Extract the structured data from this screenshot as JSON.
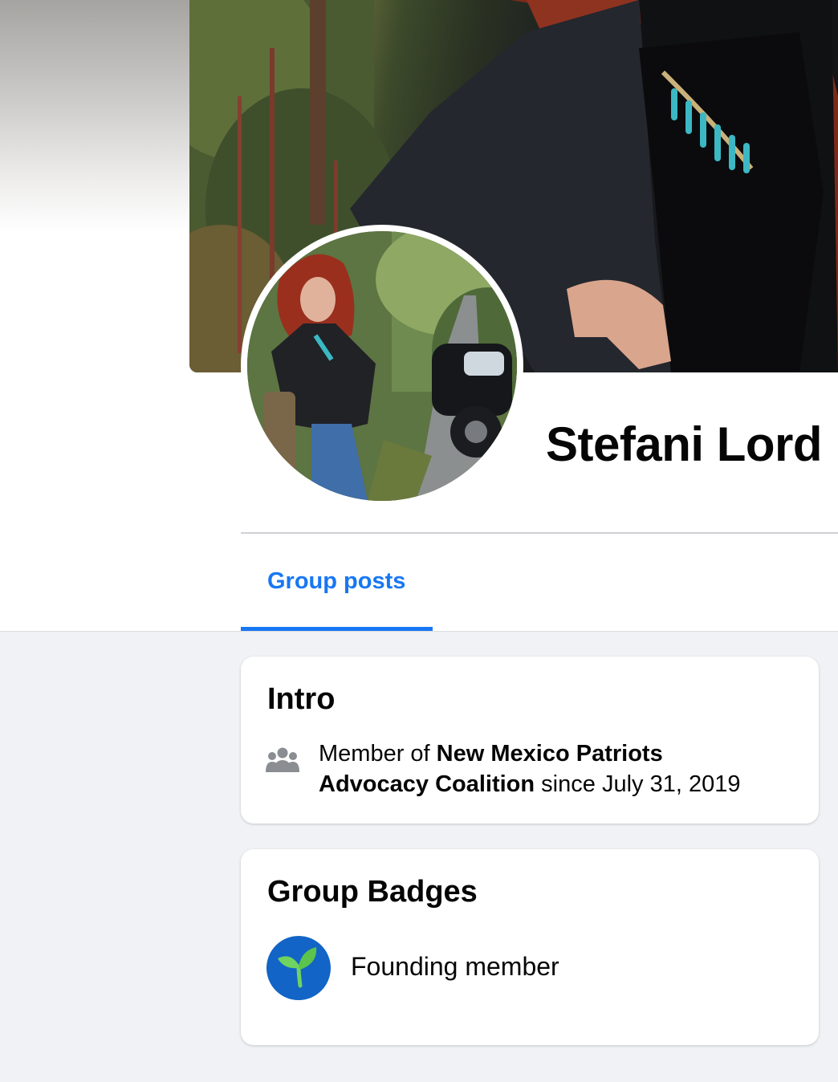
{
  "profile": {
    "name": "Stefani Lord",
    "cover_photo_icon": "cover-photo",
    "avatar_icon": "profile-photo"
  },
  "tabs": [
    {
      "label": "Group posts",
      "active": true
    }
  ],
  "intro": {
    "title": "Intro",
    "icon": "group-members-icon",
    "prefix": "Member of ",
    "group_name_line1": "New Mexico Patriots",
    "group_name_line2": "Advocacy Coalition",
    "suffix": " since July 31, 2019"
  },
  "badges": {
    "title": "Group Badges",
    "items": [
      {
        "label": "Founding member",
        "icon": "sprout-icon"
      }
    ]
  },
  "colors": {
    "accent": "#1877f2",
    "page_background": "#f0f2f5",
    "card_background": "#ffffff",
    "badge_background": "#1264c6",
    "sprout_green": "#6fd35f",
    "icon_gray": "#8a8d91"
  }
}
